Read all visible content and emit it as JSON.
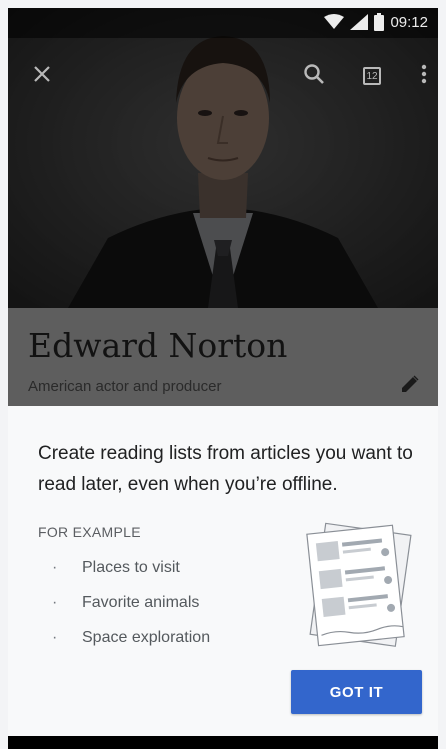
{
  "status_bar": {
    "time": "09:12",
    "icons": [
      "wifi-icon",
      "signal-icon",
      "battery-icon"
    ]
  },
  "toolbar": {
    "icons": [
      "close-icon",
      "search-icon",
      "tabs-icon",
      "more-vert-icon"
    ],
    "tab_count": "12"
  },
  "article": {
    "title": "Edward Norton",
    "description": "American actor and producer"
  },
  "sheet": {
    "headline": "Create reading lists from articles you want to read later, even when you’re offline.",
    "example_label": "FOR EXAMPLE",
    "bullet": "·",
    "examples": [
      "Places to visit",
      "Favorite animals",
      "Space exploration"
    ],
    "button_label": "GOT IT"
  },
  "colors": {
    "accent": "#3366cc",
    "sheet_background": "#f8f9fa",
    "dim_overlay": "#5e5e5e"
  }
}
